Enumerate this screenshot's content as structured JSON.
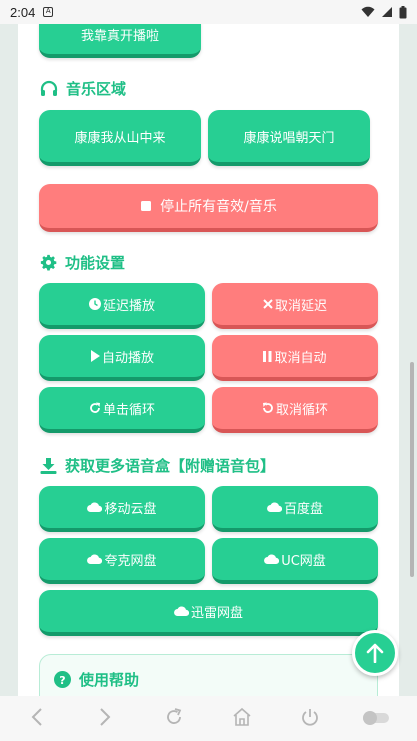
{
  "status": {
    "time": "2:04"
  },
  "top_button": {
    "label": "我靠真开播啦"
  },
  "music": {
    "title": "音乐区域",
    "items": [
      {
        "label": "康康我从山中来"
      },
      {
        "label": "康康说唱朝天门"
      }
    ],
    "stop_label": "停止所有音效/音乐"
  },
  "settings": {
    "title": "功能设置",
    "delay_play": "延迟播放",
    "cancel_delay": "取消延迟",
    "auto_play": "自动播放",
    "cancel_auto": "取消自动",
    "single_loop": "单击循环",
    "cancel_loop": "取消循环"
  },
  "download": {
    "title": "获取更多语音盒【附赠语音包】",
    "items": [
      {
        "label": "移动云盘"
      },
      {
        "label": "百度盘"
      },
      {
        "label": "夸克网盘"
      },
      {
        "label": "UC网盘"
      },
      {
        "label": "迅雷网盘"
      }
    ]
  },
  "help": {
    "title": "使用帮助"
  },
  "colors": {
    "accent": "#27cf93",
    "danger": "#ff7d7d",
    "title": "#1fbf86"
  }
}
